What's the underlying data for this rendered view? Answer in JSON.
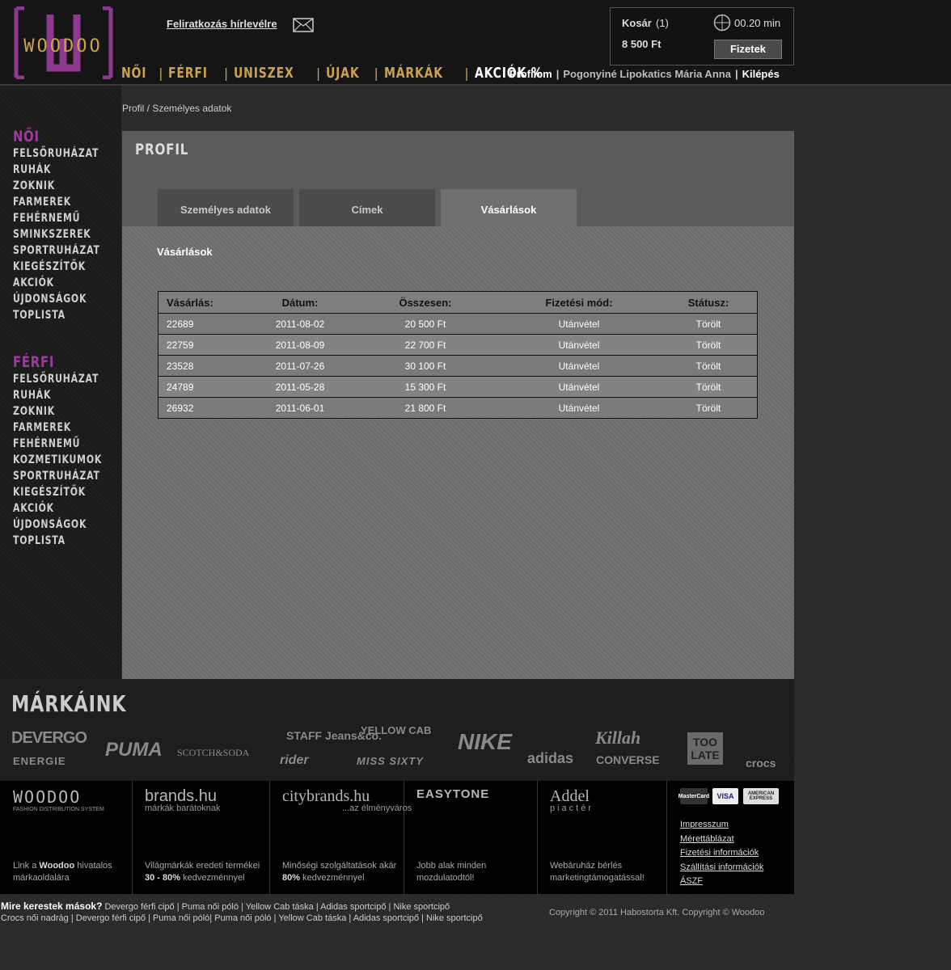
{
  "header": {
    "logo_text": "WOODOO",
    "newsletter": "Feliratkozás hírlevélre",
    "cart": {
      "label": "Kosár",
      "count": "(1)",
      "total": "8 500 Ft",
      "timer": "00.20 min",
      "pay_button": "Fizetek"
    },
    "main_nav": [
      "NŐI",
      "FÉRFI",
      "UNISZEX",
      "ÚJAK",
      "MÁRKÁK",
      "AKCIÓK %"
    ],
    "user_nav": {
      "profile": "Profilom",
      "user": "Pogonyiné Lipokatics Mária Anna",
      "logout": "Kilépés"
    }
  },
  "sidebar": {
    "women": {
      "title": "NŐI",
      "items": [
        "FELSŐRUHÁZAT",
        "RUHÁK",
        "ZOKNIK",
        "FARMEREK",
        "FEHÉRNEMŰ",
        "SMINKSZEREK",
        "SPORTRUHÁZAT",
        "KIEGÉSZÍTŐK",
        "AKCIÓK",
        "ÚJDONSÁGOK",
        "TOPLISTA"
      ]
    },
    "men": {
      "title": "FÉRFI",
      "items": [
        "FELSŐRUHÁZAT",
        "RUHÁK",
        "ZOKNIK",
        "FARMEREK",
        "FEHÉRNEMŰ",
        "KOZMETIKUMOK",
        "SPORTRUHÁZAT",
        "KIEGÉSZÍTŐK",
        "AKCIÓK",
        "ÚJDONSÁGOK",
        "TOPLISTA"
      ]
    }
  },
  "breadcrumb": "Profil / Személyes adatok",
  "profile": {
    "title": "PROFIL",
    "tabs": [
      "Személyes adatok",
      "Címek",
      "Vásárlások"
    ],
    "active_tab": "Vásárlások",
    "section_title": "Vásárlások",
    "table": {
      "headers": [
        "Vásárlás:",
        "Dátum:",
        "Összesen:",
        "Fizetési mód:",
        "Státusz:"
      ],
      "rows": [
        [
          "22689",
          "2011-08-02",
          "20 500 Ft",
          "Utánvétel",
          "Törölt"
        ],
        [
          "22759",
          "2011-08-09",
          "22 700 Ft",
          "Utánvétel",
          "Törölt"
        ],
        [
          "23528",
          "2011-07-26",
          "30 100 Ft",
          "Utánvétel",
          "Törölt"
        ],
        [
          "24789",
          "2011-05-28",
          "15 300 Ft",
          "Utánvétel",
          "Törölt"
        ],
        [
          "26932",
          "2011-06-01",
          "21 800 Ft",
          "Utánvétel",
          "Törölt"
        ]
      ]
    }
  },
  "brands": {
    "title": "MÁRKÁINK",
    "logos": [
      "DEVERGO",
      "ENERGIE",
      "PUMA",
      "SCOTCH&SODA",
      "STAFF Jeans&co.",
      "rider",
      "YELLOW CAB",
      "MISS SIXTY",
      "NIKE",
      "adidas",
      "Killah",
      "CONVERSE",
      "TOO LATE",
      "crocs"
    ]
  },
  "partners": [
    {
      "logo": "WOODOO",
      "sub": "FASHION DISTRIBUTION SYSTEM",
      "desc_pre": "Link a ",
      "desc_bold": "Woodoo",
      "desc_post": " hivatalos márkaoldalára"
    },
    {
      "logo": "brands.hu",
      "sub": "márkák barátoknak",
      "desc_pre": "Világmárkák eredeti termékei ",
      "desc_bold": "30 - 80%",
      "desc_post": " kedvezménnyel"
    },
    {
      "logo": "citybrands.hu",
      "sub": "...az élményváros",
      "desc_pre": "Minőségi szolgáltatások akár ",
      "desc_bold": "80%",
      "desc_post": " kedvezménnyel"
    },
    {
      "logo": "EASYTONE",
      "sub": "",
      "desc_pre": "Jobb alak minden mozdulatodtól!",
      "desc_bold": "",
      "desc_post": ""
    },
    {
      "logo": "Addel",
      "sub": "piactér",
      "desc_pre": "Webáruház bérlés marketingtámogatással!",
      "desc_bold": "",
      "desc_post": ""
    }
  ],
  "cards": [
    "MasterCard",
    "VISA",
    "AMERICAN EXPRESS"
  ],
  "footer_links": [
    "Impresszum",
    "Mérettáblázat",
    "Fizetési információk",
    "Szállítási információk",
    "ÁSZF"
  ],
  "searches": {
    "label": "Mire kerestek mások?",
    "line1": [
      "Devergo férfi cipő",
      "Puma női póló",
      "Yellow Cab táska",
      "Adidas sportcipő",
      "Nike sportcipő"
    ],
    "line2": [
      "Crocs női nadrág",
      "Devergo férfi cipő",
      "Puma női póló",
      "Puma női póló",
      "Yellow Cab táska",
      "Adidas sportcipő",
      "Nike sportcipő"
    ]
  },
  "copyright": "Copyright © 2011 Habostorta Kft.    Copyright © Woodoo",
  "colors": {
    "accent_gold": "#c9a24f",
    "accent_purple": "#9a3d9f",
    "background": "#2a2a2a"
  }
}
